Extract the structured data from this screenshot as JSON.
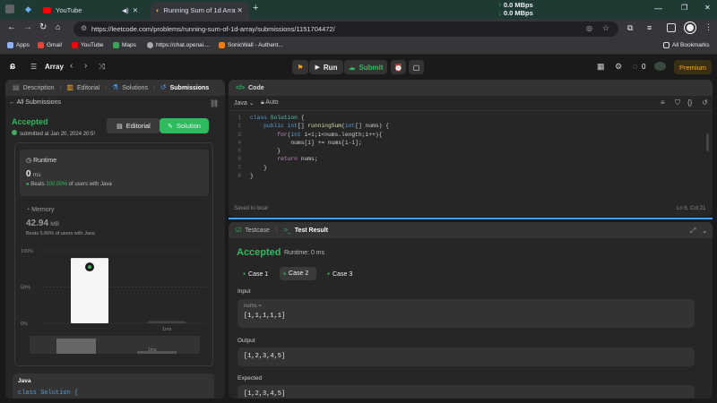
{
  "browser": {
    "tabs": [
      {
        "title": "YouTube"
      },
      {
        "title": "Running Sum of 1d Array - Lee"
      }
    ],
    "net_speed": [
      "0.0 MBps",
      "0.0 MBps"
    ],
    "url": "https://leetcode.com/problems/running-sum-of-1d-array/submissions/1151704472/",
    "bookmarks": [
      "Apps",
      "Gmail",
      "YouTube",
      "Maps",
      "https://chat.openai....",
      "SonicWall - Authent..."
    ],
    "all_bookmarks": "All Bookmarks"
  },
  "nav": {
    "problem_list": "Array",
    "run": "Run",
    "submit": "Submit",
    "streak": "0",
    "premium": "Premium"
  },
  "left_tabs": [
    "Description",
    "Editorial",
    "Solutions",
    "Submissions"
  ],
  "submission": {
    "back": "All Submissions",
    "status": "Accepted",
    "submitted": "submitted at Jan 20, 2024 20:5!",
    "editorial_btn": "Editorial",
    "solution_btn": "Solution",
    "runtime_label": "Runtime",
    "runtime_value": "0",
    "runtime_unit": "ms",
    "beats_prefix": "Beats",
    "beats_pct": "100.00%",
    "beats_suffix": "of users with Java",
    "memory_label": "Memory",
    "memory_value": "42.94",
    "memory_unit": "MB",
    "memory_beats": "Beats 5.86% of users with Java",
    "language": "Java",
    "code_peek": "class Solution {"
  },
  "chart_data": {
    "type": "bar",
    "yticks": [
      "100%",
      "50%",
      "0%"
    ],
    "xlabel_bar": "1ms",
    "mini_label": "1ms",
    "bars": [
      {
        "x": "0ms",
        "value": 0.9
      },
      {
        "x": "1ms",
        "value": 0.03
      }
    ]
  },
  "code": {
    "title": "Code",
    "language": "Java",
    "mode": "Auto",
    "lines": [
      "1",
      "2",
      "3",
      "4",
      "5",
      "6",
      "7",
      "8"
    ],
    "saved": "Saved to local",
    "position": "Ln 6, Col 21"
  },
  "result": {
    "tab_testcase": "Testcase",
    "tab_result": "Test Result",
    "status": "Accepted",
    "runtime": "Runtime: 0 ms",
    "cases": [
      "Case 1",
      "Case 2",
      "Case 3"
    ],
    "input_label": "Input",
    "var_name": "nums =",
    "input_value": "[1,1,1,1,1]",
    "output_label": "Output",
    "output_value": "[1,2,3,4,5]",
    "expected_label": "Expected",
    "expected_value": "[1,2,3,4,5]"
  },
  "colors": {
    "accent": "#2cbb5d",
    "orange": "#ffa116",
    "blue": "#4a9dff"
  }
}
